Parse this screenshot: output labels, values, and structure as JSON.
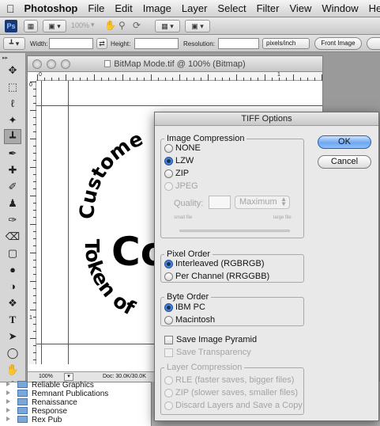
{
  "menubar": {
    "app_name": "Photoshop",
    "items": [
      "File",
      "Edit",
      "Image",
      "Layer",
      "Select",
      "Filter",
      "View",
      "Window",
      "Help"
    ]
  },
  "appbar": {
    "logo": "Ps",
    "zoom": "100%"
  },
  "options_bar": {
    "width_label": "Width:",
    "height_label": "Height:",
    "resolution_label": "Resolution:",
    "units": "pixels/inch",
    "front_image": "Front Image"
  },
  "document": {
    "title": "BitMap Mode.tif @ 100% (Bitmap)",
    "ruler_h": [
      "0",
      "1"
    ],
    "ruler_v": [
      "0",
      "1"
    ],
    "zoom": "100%",
    "doc_info": "Doc: 30.0K/30.0K",
    "canvas_text": {
      "arc_top": "Custome",
      "center": "Co",
      "arc_bottom": "Token of"
    }
  },
  "list_panel": {
    "items": [
      "Reliable Graphics",
      "Remnant Publications",
      "Renaissance",
      "Response",
      "Rex Pub"
    ]
  },
  "tiff_dialog": {
    "title": "TIFF Options",
    "ok": "OK",
    "cancel": "Cancel",
    "image_compression": {
      "title": "Image Compression",
      "options": [
        "NONE",
        "LZW",
        "ZIP",
        "JPEG"
      ],
      "selected": "LZW",
      "quality_label": "Quality:",
      "quality_value": "",
      "quality_preset": "Maximum",
      "small_file": "small file",
      "large_file": "large file"
    },
    "pixel_order": {
      "title": "Pixel Order",
      "options": [
        "Interleaved (RGBRGB)",
        "Per Channel (RRGGBB)"
      ],
      "selected": "Interleaved (RGBRGB)"
    },
    "byte_order": {
      "title": "Byte Order",
      "options": [
        "IBM PC",
        "Macintosh"
      ],
      "selected": "IBM PC"
    },
    "save_image_pyramid": "Save Image Pyramid",
    "save_transparency": "Save Transparency",
    "layer_compression": {
      "title": "Layer Compression",
      "options": [
        "RLE (faster saves, bigger files)",
        "ZIP (slower saves, smaller files)",
        "Discard Layers and Save a Copy"
      ]
    }
  },
  "colors": {
    "accent": "#2e66c4",
    "ps_blue": "#173a78"
  }
}
